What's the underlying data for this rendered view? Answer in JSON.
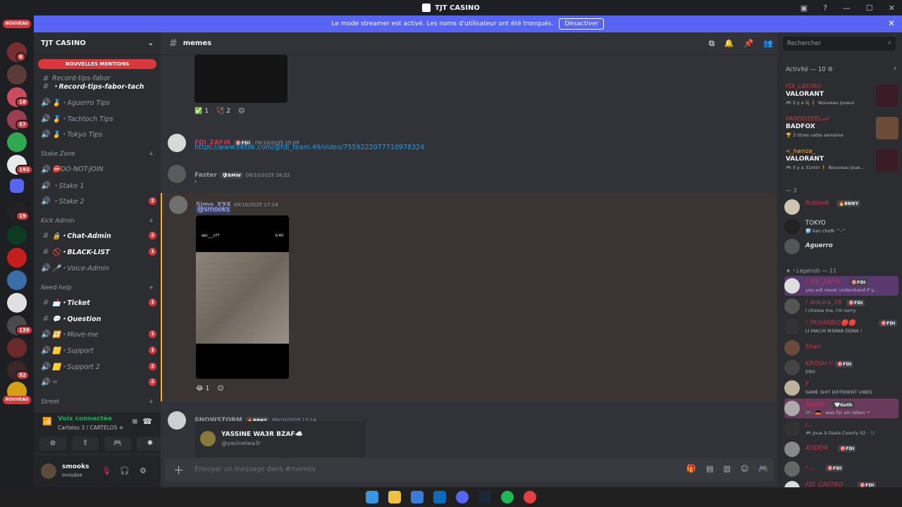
{
  "window": {
    "title": "TJT CASINO"
  },
  "banner": {
    "text": "Le mode streamer est activé. Les noms d'utilisateur ont été tronqués.",
    "button": "Désactiver"
  },
  "guilds": {
    "new_top": "NOUVEAU",
    "new_bottom": "NOUVEAU",
    "badges": [
      "6",
      "18",
      "57",
      "192",
      "19",
      "139",
      "52"
    ]
  },
  "server": {
    "name": "TJT CASINO",
    "mentions": "NOUVELLES MENTIONS"
  },
  "channels": [
    {
      "icon": "#",
      "name": "Record-tips-fabor",
      "badge": ""
    },
    {
      "icon": "#",
      "name": "・Record-tips-fabor-tach",
      "badge": "",
      "bright": true
    },
    {
      "icon": "🔊",
      "name": "🥇・Aguerro Tips",
      "badge": ""
    },
    {
      "icon": "🔊",
      "name": "🥇・Tachtoch Tips",
      "badge": ""
    },
    {
      "icon": "🔊",
      "name": "🥇・Tokyo Tips",
      "badge": ""
    }
  ],
  "categories": {
    "stake": "Stake Zone",
    "kick": "Kick Admin",
    "need": "Need-help",
    "street": "Street"
  },
  "stake_channels": [
    {
      "icon": "🔊",
      "name": "⛔DO-NOT-JOIN",
      "badge": ""
    },
    {
      "icon": "🔊",
      "name": "・Stake 1",
      "badge": ""
    },
    {
      "icon": "🔊",
      "name": "・Stake 2",
      "badge": "2"
    }
  ],
  "kick_channels": [
    {
      "icon": "#",
      "name": "🔒・Chat-Admin",
      "badge": "2",
      "bright": true
    },
    {
      "icon": "#",
      "name": "🚫・BLACK-LIST",
      "badge": "1",
      "bright": true
    },
    {
      "icon": "🔊",
      "name": "🎤・Voice-Admin",
      "badge": ""
    }
  ],
  "need_channels": [
    {
      "icon": "#",
      "name": "📩・Ticket",
      "badge": "1",
      "bright": true
    },
    {
      "icon": "#",
      "name": "💬・Question",
      "badge": "",
      "bright": true
    },
    {
      "icon": "🔊",
      "name": "🔁・Move-me",
      "badge": "1"
    },
    {
      "icon": "🔊",
      "name": "🟨・Support",
      "badge": "1"
    },
    {
      "icon": "🔊",
      "name": "🟨・Support 2",
      "badge": "2"
    },
    {
      "icon": "🔊",
      "name": "=",
      "badge": "2"
    }
  ],
  "voice": {
    "status": "Voix connectée",
    "channel": "Cartelos 3 / CARTELOS ✡"
  },
  "user": {
    "name": "smooks",
    "status": "Invisible"
  },
  "chat": {
    "channel": "memes",
    "placeholder": "Envoyer un message dans #memes",
    "reactions1": [
      {
        "emoji": "✅",
        "count": "1"
      },
      {
        "emoji": "🏹",
        "count": "2"
      }
    ],
    "msg1": {
      "name": "FDI_ZAFIR",
      "tag": "🎯FDI",
      "time": "09/10/2025 15:09",
      "link": "https://www.tiktok.com/@fdi_team.49/video/7559222077710978324"
    },
    "msg2": {
      "name": "Faster",
      "tag": "🛡BMW",
      "time": "09/10/2025 16:22",
      "text": ","
    },
    "msg3": {
      "name": "Simo_X9X",
      "time": "09/10/2025 17:14",
      "mention": "@smooks",
      "video_user": "abc___z77",
      "video_time": "0:40"
    },
    "reactions3": [
      {
        "emoji": "😂",
        "count": "1"
      }
    ],
    "msg4": {
      "name": "SNOWSTORM",
      "tag": "🔥BBNY",
      "time": "09/10/2025 17:14",
      "embed_title": "YASSINE WA3R BZAF☁️",
      "embed_sub": "@yasinelwa3r"
    }
  },
  "members": {
    "search": "Rechercher",
    "activity": "Activité — 10 ⚙",
    "activities": [
      {
        "name": "FDI_CASTRO",
        "game": "VALORANT",
        "sub": "🎮 il y a 2j  🚶 Nouveau joueur",
        "color": "#c9364d"
      },
      {
        "name": "FADEEEEEEL🏎",
        "game": "BADFOX",
        "sub": "🏆 3 titres cette semaine",
        "color": "#6b4b3a"
      },
      {
        "name": "<_hamza_",
        "game": "VALORANT",
        "sub": "🎮 il y a 31min  🚶 Nouveau joue...",
        "color": "#c9364d"
      }
    ],
    "group1": "— 3",
    "online": [
      {
        "name": "RobbeN",
        "tag": "🔥BBNY",
        "sub": "",
        "color": "#c9364d"
      },
      {
        "name": "TOKYO",
        "tag": "",
        "sub": "🧊 kan chofk ^-^",
        "color": "#dbdee1"
      },
      {
        "name": "Aguerro",
        "tag": "",
        "sub": "",
        "color": "#dbdee1"
      }
    ],
    "group2": "★・Legends — 11",
    "legends": [
      {
        "name": "! FDI_ZAFIR",
        "tag": "🎯FDI",
        "sub": "you will never understand if y...",
        "color": "#c9364d"
      },
      {
        "name": "! Ankara_16",
        "tag": "🎯FDI",
        "sub": "I chosse me, I'm sorry",
        "color": "#c9364d"
      },
      {
        "name": "! TKHARBIQ🔴🔴",
        "tag": "🎯FDI",
        "sub": "LI MACHI M3ANA DDNA !",
        "color": "#c9364d"
      },
      {
        "name": "Shan",
        "tag": "",
        "sub": "",
        "color": "#c9364d"
      },
      {
        "name": "KROSH !!",
        "tag": "🎯FDI",
        "sub": "ERO",
        "color": "#c9364d"
      },
      {
        "name": "F",
        "tag": "",
        "sub": "SAME SHIT DIFFERENT VIBES",
        "color": "#c9364d"
      },
      {
        "name": "Gothic",
        "tag": "🤍Goth",
        "sub": "🎮 · 🇩🇪 · was für ein leben ᵒᵒ",
        "color": "#c9364d"
      },
      {
        "name": "/...",
        "tag": "",
        "sub": "🎮 Joue à Oasis County S2 · 🎶",
        "color": "#c9364d"
      },
      {
        "name": "XODEM",
        "tag": "🎯FDI",
        "sub": "",
        "color": "#c9364d"
      },
      {
        "name": "! ...",
        "tag": "🎯FDI",
        "sub": "",
        "color": "#c9364d"
      },
      {
        "name": "FDI_CASTRO",
        "tag": "🎯FDI",
        "sub": "",
        "color": "#c9364d"
      }
    ]
  }
}
